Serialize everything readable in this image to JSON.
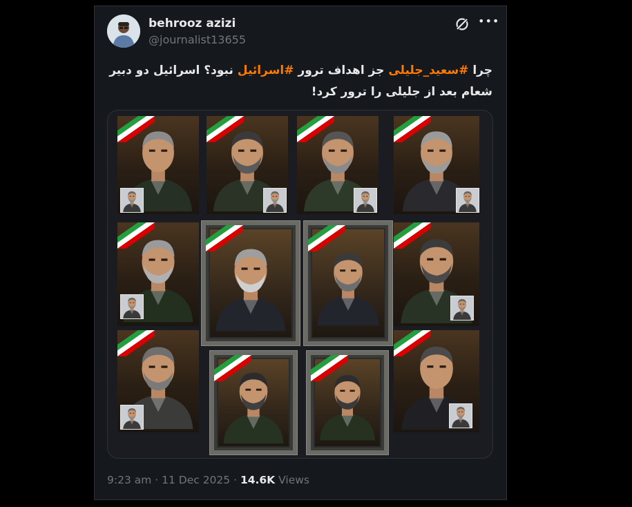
{
  "author": {
    "name": "behrooz azizi",
    "handle": "@journalist13655"
  },
  "tweet": {
    "line1_pre": "چرا ",
    "hashtag1": "#سعید_جلیلی",
    "line1_mid": " جز اهداف ترور ",
    "hashtag2": "#اسرائیل",
    "line1_post": " نبود؟  اسرائیل دو دبیر",
    "line2": "شعام بعد از جلیلی را ترور کرد!"
  },
  "icons": {
    "grok": "grok-icon",
    "more": "more-icon"
  },
  "more_glyph": "•••",
  "meta": {
    "time": "9:23 am",
    "sep1": " · ",
    "date": "11 Dec 2025",
    "sep2": " · ",
    "views_count": "14.6K",
    "views_label": " Views"
  },
  "colors": {
    "hashtag": "#ff7a00",
    "text": "#e7e9ea",
    "muted": "#71767b",
    "background": "#15181c"
  }
}
